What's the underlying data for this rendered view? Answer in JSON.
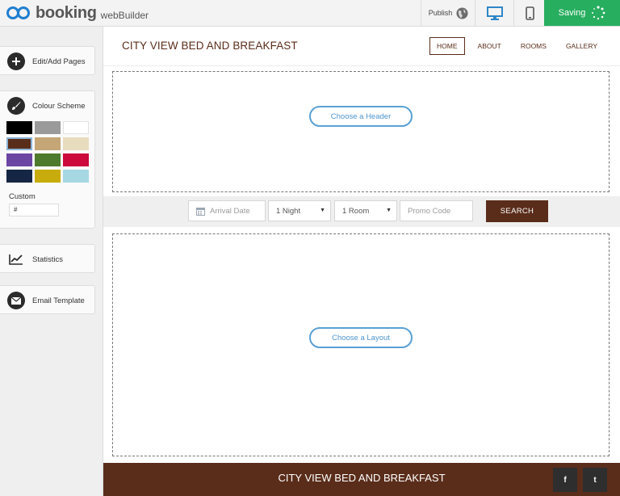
{
  "brand": {
    "logo_word": "booking",
    "logo_sub": "webBuilder"
  },
  "toolbar": {
    "publish_label": "Publish",
    "saving_label": "Saving",
    "desktop_icon": "desktop-icon",
    "mobile_icon": "mobile-icon",
    "accent_color": "#27ae5f"
  },
  "sidebar": {
    "edit_pages_label": "Edit/Add Pages",
    "colour_scheme_label": "Colour Scheme",
    "swatches": [
      "#000000",
      "#9a9a9a",
      "#ffffff",
      "#5a2d1a",
      "#c4a677",
      "#e8dcbf",
      "#6b46a3",
      "#4e7a2c",
      "#cc0a3c",
      "#152544",
      "#c7ac0c",
      "#a5d8e2"
    ],
    "selected_swatch": "#5a2d1a",
    "custom_label": "Custom",
    "custom_value": "#",
    "statistics_label": "Statistics",
    "email_template_label": "Email Template"
  },
  "site": {
    "title": "CITY VIEW BED AND BREAKFAST",
    "nav": [
      "HOME",
      "ABOUT",
      "ROOMS",
      "GALLERY"
    ],
    "active_nav": "HOME",
    "brand_color": "#5a2d1a"
  },
  "builder": {
    "header_button": "Choose a Header",
    "layout_button": "Choose a Layout"
  },
  "search": {
    "arrival_placeholder": "Arrival Date",
    "nights_value": "1 Night",
    "rooms_value": "1 Room",
    "promo_placeholder": "Promo Code",
    "search_label": "SEARCH"
  },
  "footer": {
    "title": "CITY VIEW BED AND BREAKFAST",
    "social": [
      "f",
      "t"
    ]
  }
}
